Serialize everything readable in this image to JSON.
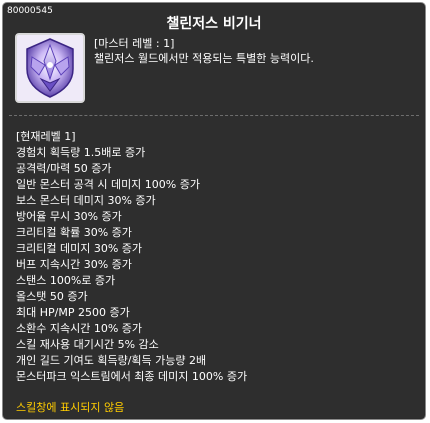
{
  "skill_id": "80000545",
  "title": "챌린저스 비기너",
  "master_level_text": "[마스터 레벨 : 1]",
  "description": "챌린저스 월드에서만 적용되는 특별한 능력이다.",
  "icon_name": "challengers-emblem-icon",
  "current_level_text": "[현재레벨 1]",
  "effects": [
    "경험치 획득량 1.5배로 증가",
    "공격력/마력 50 증가",
    "일반 몬스터 공격 시 데미지 100% 증가",
    "보스 몬스터  데미지 30% 증가",
    "방어율 무시 30% 증가",
    "크리티컬 확률 30% 증가",
    "크리티컬 데미지 30% 증가",
    "버프 지속시간 30% 증가",
    "스탠스 100%로 증가",
    "올스탯 50 증가",
    "최대 HP/MP 2500 증가",
    "소환수 지속시간 10% 증가",
    "스킬 재사용 대기시간 5% 감소",
    "개인 길드 기여도 획득량/획득 가능량 2배",
    "몬스터파크 익스트림에서 최종 데미지 100% 증가"
  ],
  "footer_note": "스킬창에 표시되지 않음",
  "colors": {
    "background": "#1e1e1e",
    "text": "#ffffff",
    "note": "#ffcc00",
    "icon_primary": "#7b5fd0"
  }
}
